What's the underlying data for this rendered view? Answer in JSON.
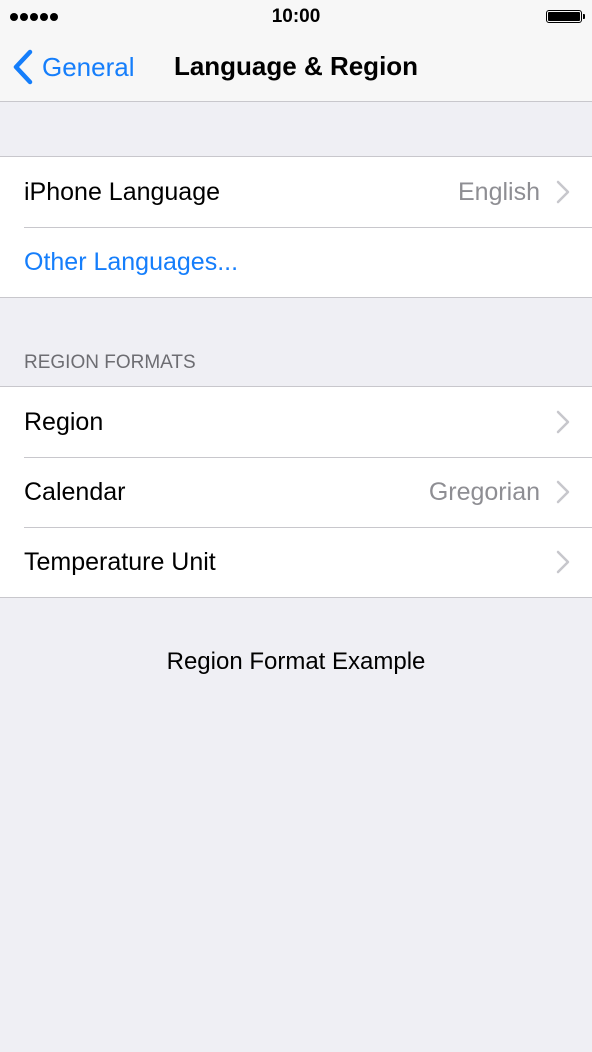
{
  "status_bar": {
    "time": "10:00",
    "signal_icon": "signal-dots-icon",
    "battery_icon": "battery-icon",
    "battery_level": 1.0
  },
  "nav": {
    "back_label": "General",
    "back_icon": "chevron-left-icon",
    "title": "Language & Region",
    "accent_color": "#157efb"
  },
  "language_group": {
    "iphone_language": {
      "label": "iPhone Language",
      "value": "English"
    },
    "other_languages": {
      "label": "Other Languages..."
    }
  },
  "region_formats": {
    "header": "REGION FORMATS",
    "items": [
      {
        "label": "Region",
        "value": ""
      },
      {
        "label": "Calendar",
        "value": "Gregorian"
      },
      {
        "label": "Temperature Unit",
        "value": ""
      }
    ]
  },
  "example_title": "Region Format Example"
}
